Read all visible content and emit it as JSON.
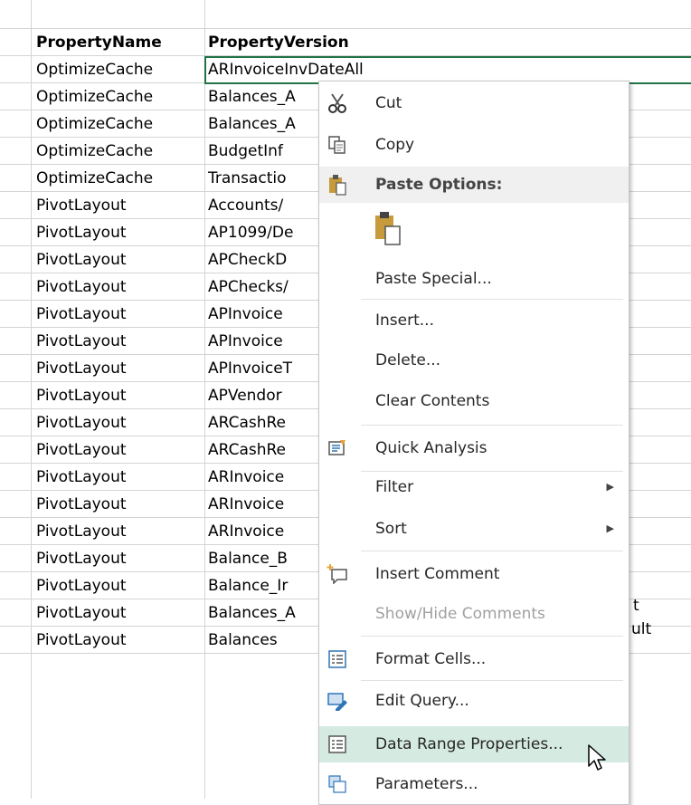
{
  "sheet": {
    "headers": [
      "PropertyName",
      "PropertyVersion"
    ],
    "rows": [
      [
        "OptimizeCache",
        "ARInvoiceInvDateAll"
      ],
      [
        "OptimizeCache",
        "Balances_A"
      ],
      [
        "OptimizeCache",
        "Balances_A"
      ],
      [
        "OptimizeCache",
        "BudgetInf"
      ],
      [
        "OptimizeCache",
        "Transactio"
      ],
      [
        "PivotLayout",
        "Accounts/"
      ],
      [
        "PivotLayout",
        "AP1099/De"
      ],
      [
        "PivotLayout",
        "APCheckD"
      ],
      [
        "PivotLayout",
        "APChecks/"
      ],
      [
        "PivotLayout",
        "APInvoice"
      ],
      [
        "PivotLayout",
        "APInvoice"
      ],
      [
        "PivotLayout",
        "APInvoiceT"
      ],
      [
        "PivotLayout",
        "APVendor"
      ],
      [
        "PivotLayout",
        "ARCashRe"
      ],
      [
        "PivotLayout",
        "ARCashRe"
      ],
      [
        "PivotLayout",
        "ARInvoice"
      ],
      [
        "PivotLayout",
        "ARInvoice"
      ],
      [
        "PivotLayout",
        "ARInvoice"
      ],
      [
        "PivotLayout",
        "Balance_B"
      ],
      [
        "PivotLayout",
        "Balance_Ir"
      ],
      [
        "PivotLayout",
        "Balances_A"
      ],
      [
        "PivotLayout",
        "Balances"
      ]
    ],
    "overflow": {
      "row16": "t",
      "row17": "ult"
    },
    "accent": "#217346"
  },
  "menu": {
    "cut": "Cut",
    "copy": "Copy",
    "paste_options": "Paste Options:",
    "paste_special": "Paste Special...",
    "insert": "Insert...",
    "delete": "Delete...",
    "clear_contents": "Clear Contents",
    "quick_analysis": "Quick Analysis",
    "filter": "Filter",
    "sort": "Sort",
    "insert_comment": "Insert Comment",
    "show_hide_comments": "Show/Hide Comments",
    "format_cells": "Format Cells...",
    "edit_query": "Edit Query...",
    "data_range_properties": "Data Range Properties...",
    "parameters": "Parameters...",
    "highlight": "#d5ebe2"
  }
}
